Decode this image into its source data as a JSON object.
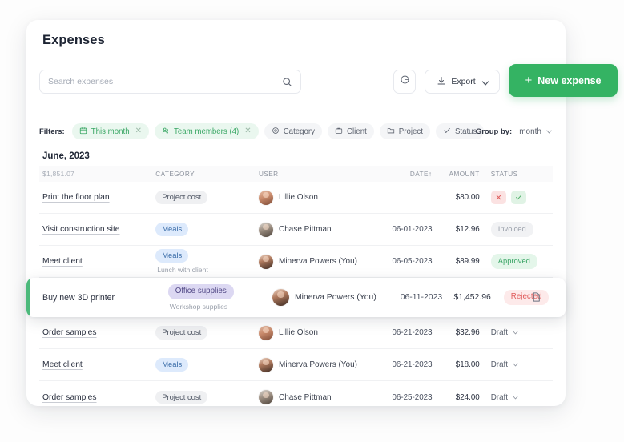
{
  "header": {
    "title": "Expenses"
  },
  "search": {
    "placeholder": "Search expenses",
    "value": "",
    "icon": "search-icon"
  },
  "toolbar": {
    "chart_button_icon": "pie-chart-icon",
    "export_label": "Export",
    "export_icon": "download-icon",
    "export_chevron": "chevron-down-icon",
    "new_expense_label": "New expense",
    "new_expense_plus": "+",
    "accent_color": "#34b363"
  },
  "filters": {
    "label": "Filters:",
    "chips": [
      {
        "label": "This month",
        "icon": "calendar-icon",
        "active": true,
        "removable": true
      },
      {
        "label": "Team members (4)",
        "icon": "users-icon",
        "active": true,
        "removable": true
      },
      {
        "label": "Category",
        "icon": "tag-icon",
        "active": false,
        "removable": false
      },
      {
        "label": "Client",
        "icon": "briefcase-icon",
        "active": false,
        "removable": false
      },
      {
        "label": "Project",
        "icon": "folder-icon",
        "active": false,
        "removable": false
      },
      {
        "label": "Status",
        "icon": "check-icon",
        "active": false,
        "removable": false
      }
    ],
    "group_by_label": "Group by:",
    "group_by_value": "month",
    "group_by_chevron": "chevron-down-icon"
  },
  "table": {
    "group_title": "June, 2023",
    "group_total": "$1,851.07",
    "columns": {
      "category": "CATEGORY",
      "user": "USER",
      "date": "DATE",
      "date_sort": "↑",
      "amount": "AMOUNT",
      "status": "STATUS"
    },
    "rows": [
      {
        "name": "Print the floor plan",
        "category": "Project cost",
        "category_color": "gray",
        "note": "",
        "user": "Lillie Olson",
        "avatar": "avatar-lillie-olson",
        "date": "",
        "amount": "$80.00",
        "status_type": "actions",
        "status": "",
        "action_reject": "×",
        "action_approve": "✓"
      },
      {
        "name": "Visit construction site",
        "category": "Meals",
        "category_color": "blue",
        "note": "",
        "user": "Chase Pittman",
        "avatar": "avatar-chase-pittman",
        "date": "06-01-2023",
        "amount": "$12.96",
        "status_type": "badge",
        "status": "Invoiced",
        "status_color": "gray"
      },
      {
        "name": "Meet client",
        "category": "Meals",
        "category_color": "blue",
        "note": "Lunch with client",
        "user": "Minerva Powers (You)",
        "avatar": "avatar-minerva-powers",
        "date": "06-05-2023",
        "amount": "$89.99",
        "status_type": "badge",
        "status": "Approved",
        "status_color": "green"
      },
      {
        "name": "Buy new 3D printer",
        "category": "Office supplies",
        "category_color": "purple",
        "note": "Workshop supplies",
        "user": "Minerva Powers (You)",
        "avatar": "avatar-minerva-powers",
        "date": "06-11-2023",
        "amount": "$1,452.96",
        "status_type": "badge",
        "status": "Rejected",
        "status_color": "red",
        "highlighted": true,
        "attachment_icon": "document-icon"
      },
      {
        "name": "Order samples",
        "category": "Project cost",
        "category_color": "gray",
        "note": "",
        "user": "Lillie Olson",
        "avatar": "avatar-lillie-olson",
        "date": "06-21-2023",
        "amount": "$32.96",
        "status_type": "dropdown",
        "status": "Draft"
      },
      {
        "name": "Meet client",
        "category": "Meals",
        "category_color": "blue",
        "note": "",
        "user": "Minerva Powers (You)",
        "avatar": "avatar-minerva-powers",
        "date": "06-21-2023",
        "amount": "$18.00",
        "status_type": "dropdown",
        "status": "Draft"
      },
      {
        "name": "Order samples",
        "category": "Project cost",
        "category_color": "gray",
        "note": "",
        "user": "Chase Pittman",
        "avatar": "avatar-chase-pittman",
        "date": "06-25-2023",
        "amount": "$24.00",
        "status_type": "dropdown",
        "status": "Draft"
      }
    ]
  }
}
